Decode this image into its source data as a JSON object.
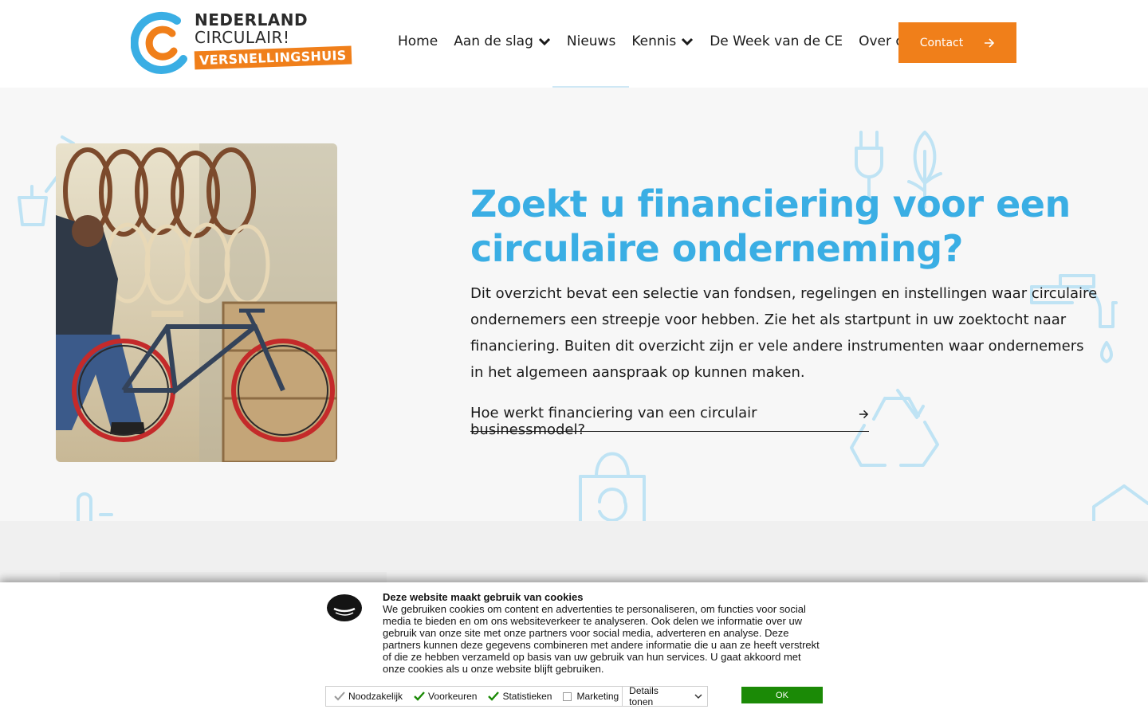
{
  "header": {
    "logo": {
      "line1": "NEDERLAND",
      "line2": "CIRCULAIR!",
      "line3": "VERSNELLINGSHUIS",
      "colors": {
        "orange": "#f07f1a",
        "blue": "#3aaee4"
      }
    },
    "nav": [
      {
        "label": "Home",
        "has_dropdown": false
      },
      {
        "label": "Aan de slag",
        "has_dropdown": true
      },
      {
        "label": "Nieuws",
        "has_dropdown": false
      },
      {
        "label": "Kennis",
        "has_dropdown": true
      },
      {
        "label": "De Week van de CE",
        "has_dropdown": false
      },
      {
        "label": "Over ons",
        "has_dropdown": false
      }
    ],
    "contact_label": "Contact",
    "contact_icon": "arrow-right-icon"
  },
  "hero": {
    "title": "Zoekt u financiering voor een circulaire onderneming?",
    "body": "Dit overzicht bevat een selectie van fondsen, regelingen en instellingen waar circulaire ondernemers een streepje voor hebben. Zie het als startpunt in uw zoektocht naar financiering. Buiten dit overzicht zijn er vele andere instrumenten waar ondernemers in het algemeen aanspraak op kunnen maken.",
    "link_label": "Hoe werkt financiering van een circulair businessmodel?",
    "link_icon": "arrow-right-icon",
    "image": "bicycle-workshop-photo",
    "accent_color": "#3aaee4"
  },
  "cookie_banner": {
    "title": "Deze website maakt gebruik van cookies",
    "text": "We gebruiken cookies om content en advertenties te personaliseren, om functies voor social media te bieden en om ons websiteverkeer te analyseren. Ook delen we informatie over uw gebruik van onze site met onze partners voor social media, adverteren en analyse. Deze partners kunnen deze gegevens combineren met andere informatie die u aan ze heeft verstrekt of die ze hebben verzameld op basis van uw gebruik van hun services. U gaat akkoord met onze cookies als u onze website blijft gebruiken.",
    "options": [
      {
        "label": "Noodzakelijk",
        "checked": true,
        "disabled": true
      },
      {
        "label": "Voorkeuren",
        "checked": true,
        "disabled": false
      },
      {
        "label": "Statistieken",
        "checked": true,
        "disabled": false
      },
      {
        "label": "Marketing",
        "checked": false,
        "disabled": false
      }
    ],
    "details_label": "Details tonen",
    "ok_label": "OK",
    "ok_color": "#1b8a06"
  }
}
